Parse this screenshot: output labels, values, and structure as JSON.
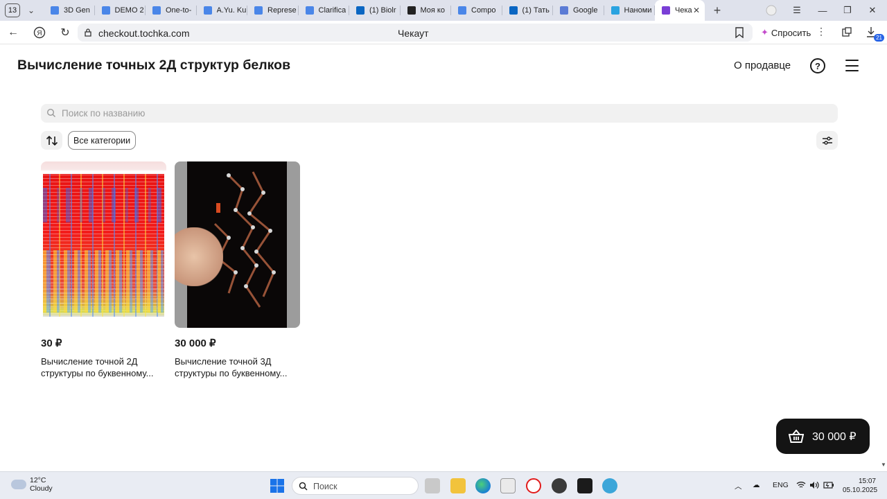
{
  "browser": {
    "tab_count": "13",
    "tabs": [
      {
        "title": "3D Gen",
        "color": "#4a86e8"
      },
      {
        "title": "DEMO 2",
        "color": "#4a86e8"
      },
      {
        "title": "One-to-",
        "color": "#4a86e8"
      },
      {
        "title": "A.Yu. Ku",
        "color": "#4a86e8"
      },
      {
        "title": "Represe",
        "color": "#4a86e8"
      },
      {
        "title": "Clarifica",
        "color": "#4a86e8"
      },
      {
        "title": "(1) Biolr",
        "color": "#0a66c2"
      },
      {
        "title": "Моя ко",
        "color": "#222222"
      },
      {
        "title": "Compo",
        "color": "#4a86e8"
      },
      {
        "title": "(1) Тать",
        "color": "#0a66c2"
      },
      {
        "title": "Google",
        "color": "#5b7bd5"
      },
      {
        "title": "Наноми",
        "color": "#2aa3e0"
      }
    ],
    "active_tab": {
      "title": "Чека",
      "color": "#7a3fd6"
    },
    "url": "checkout.tochka.com",
    "page_title": "Чекаут",
    "ask_label": "Спросить",
    "downloads_badge": "21"
  },
  "shop": {
    "title": "Вычисление точных 2Д структур белков",
    "seller_link": "О продавце",
    "help_label": "?",
    "search_placeholder": "Поиск по названию",
    "category_chip": "Все категории"
  },
  "products": [
    {
      "price": "30 ₽",
      "name_line1": "Вычисление точной 2Д",
      "name_line2": "структуры по буквенному..."
    },
    {
      "price": "30 000 ₽",
      "name_line1": "Вычисление точной 3Д",
      "name_line2": "структуры по буквенному..."
    }
  ],
  "cart": {
    "total": "30 000 ₽"
  },
  "taskbar": {
    "temperature": "12°C",
    "weather": "Cloudy",
    "search_placeholder": "Поиск",
    "language": "ENG",
    "time": "15:07",
    "date": "05.10.2025"
  }
}
